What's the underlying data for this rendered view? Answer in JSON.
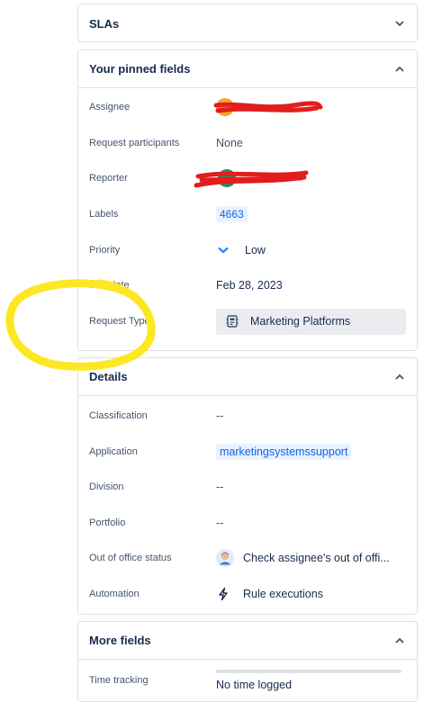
{
  "panels": {
    "slas": {
      "title": "SLAs",
      "state": "collapsed"
    },
    "pinned": {
      "title": "Your pinned fields",
      "state": "expanded",
      "rows": [
        {
          "label": "Assignee",
          "value": ""
        },
        {
          "label": "Request participants",
          "value": "None"
        },
        {
          "label": "Reporter",
          "value": ""
        },
        {
          "label": "Labels",
          "value": "4663"
        },
        {
          "label": "Priority",
          "value": "Low",
          "icon": "chevron-down-icon"
        },
        {
          "label": "Due date",
          "value": "Feb 28, 2023"
        },
        {
          "label": "Request Type",
          "value": "Marketing Platforms",
          "icon": "request-type-icon"
        }
      ]
    },
    "details": {
      "title": "Details",
      "state": "expanded",
      "rows": [
        {
          "label": "Classification",
          "value": "--"
        },
        {
          "label": "Application",
          "value": "marketingsystemssupport"
        },
        {
          "label": "Division",
          "value": "--"
        },
        {
          "label": "Portfolio",
          "value": "--"
        },
        {
          "label": "Out of office status",
          "value": "Check assignee's out of offi...",
          "icon": "person-avatar-icon"
        },
        {
          "label": "Automation",
          "value": "Rule executions",
          "icon": "lightning-icon"
        }
      ]
    },
    "more": {
      "title": "More fields",
      "state": "expanded",
      "rows": [
        {
          "label": "Time tracking",
          "value": "No time logged"
        }
      ]
    }
  },
  "colors": {
    "accent": "#0c66e4",
    "chip_bg": "#e9f2ff",
    "annotation_yellow": "#fde725",
    "redaction_red": "#e21d1d",
    "priority_low": "#2684ff"
  }
}
